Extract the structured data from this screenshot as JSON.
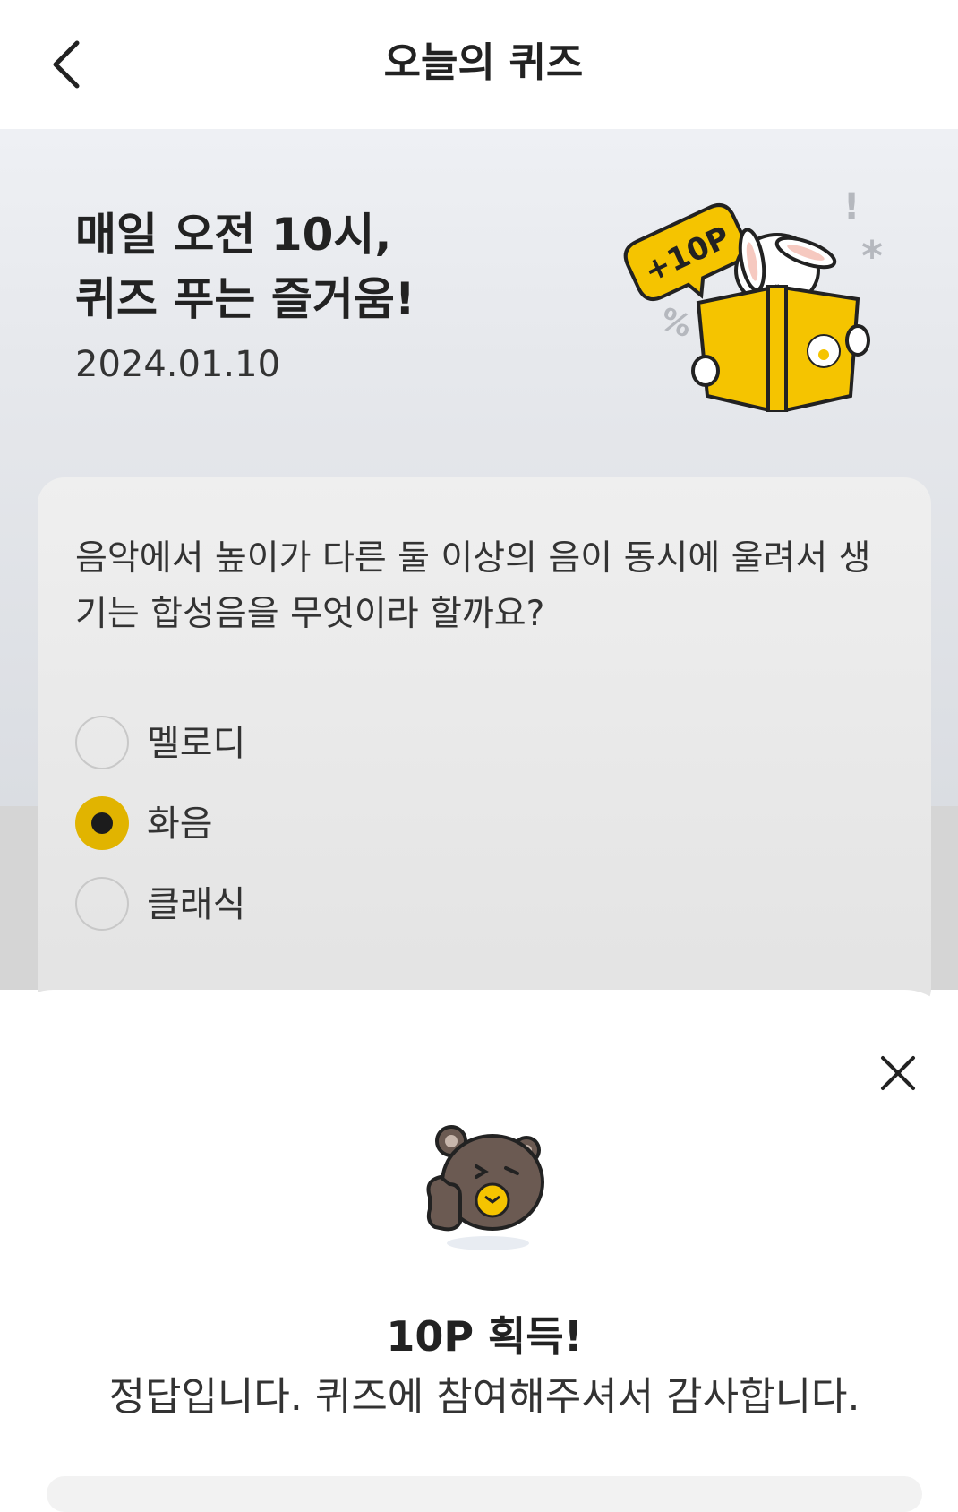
{
  "header": {
    "title": "오늘의 퀴즈",
    "back_icon": "chevron-left-icon"
  },
  "hero": {
    "title_line1": "매일 오전 10시,",
    "title_line2": "퀴즈 푸는 즐거움!",
    "date": "2024.01.10",
    "badge": "+10P"
  },
  "quiz": {
    "question": "음악에서 높이가 다른 둘 이상의 음이 동시에 울려서 생기는 합성음을 무엇이라 할까요?",
    "options": [
      {
        "label": "멜로디",
        "selected": false
      },
      {
        "label": "화음",
        "selected": true
      },
      {
        "label": "클래식",
        "selected": false
      }
    ]
  },
  "result": {
    "title": "10P 획득!",
    "message": "정답입니다. 퀴즈에 참여해주셔서 감사합니다."
  },
  "colors": {
    "accent": "#e1b400",
    "book": "#f5c400",
    "bear": "#6b5a52"
  }
}
